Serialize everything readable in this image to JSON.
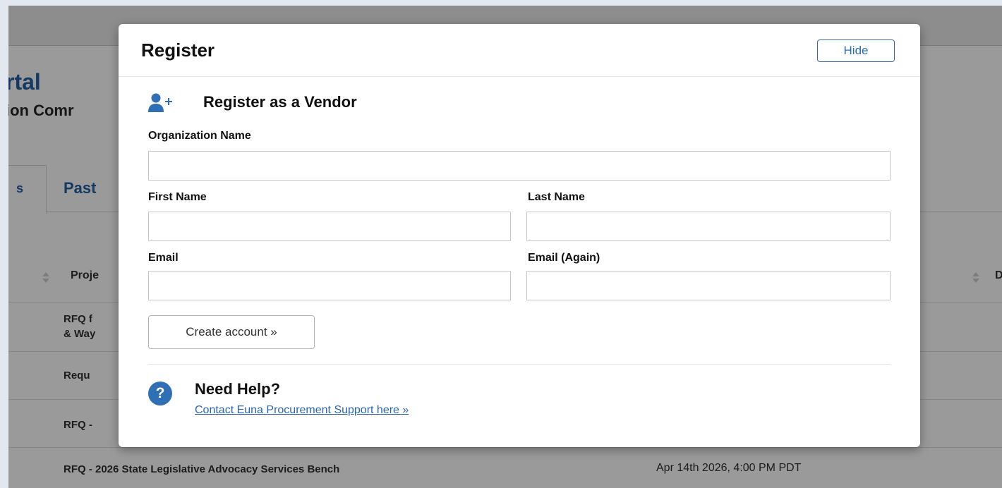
{
  "background": {
    "portal_title_fragment": "rtal",
    "portal_subtitle_fragment": "ion Comr",
    "tabs": [
      {
        "label": "s"
      },
      {
        "label": "Past"
      }
    ],
    "table": {
      "column_project": "Proje",
      "column_due_fragment": "D",
      "rows": [
        {
          "line1": "RFQ f",
          "line2": "& Way",
          "date": ""
        },
        {
          "line1": "Requ",
          "line2": "",
          "date": ""
        },
        {
          "line1": "RFQ -",
          "line2": "",
          "date": ""
        },
        {
          "line1": "RFQ - 2026 State Legislative Advocacy Services Bench",
          "line2": "",
          "date": "Apr 14th 2026, 4:00 PM PDT"
        }
      ]
    }
  },
  "modal": {
    "title": "Register",
    "hide_label": "Hide",
    "section_title": "Register as a Vendor",
    "fields": {
      "organization_name": {
        "label": "Organization Name",
        "value": ""
      },
      "first_name": {
        "label": "First Name",
        "value": ""
      },
      "last_name": {
        "label": "Last Name",
        "value": ""
      },
      "email": {
        "label": "Email",
        "value": ""
      },
      "email_again": {
        "label": "Email (Again)",
        "value": ""
      }
    },
    "create_button_label": "Create account »",
    "help": {
      "title": "Need Help?",
      "link_text": "Contact Euna Procurement Support here »"
    }
  },
  "colors": {
    "accent": "#2e6fb5",
    "link": "#2a64b4",
    "overlay_bg": "#9a9a9a"
  },
  "icons": {
    "vendor_icon": "user-plus-icon",
    "help_icon": "question-circle-icon",
    "sort_icon": "sort-icon"
  }
}
